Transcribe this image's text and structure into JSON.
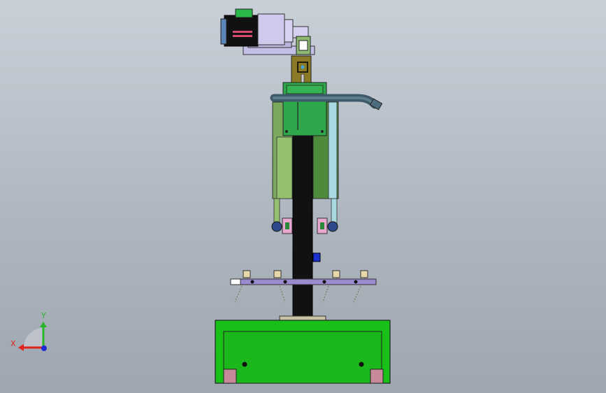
{
  "viewport": {
    "background_top": "#c9d0d8",
    "background_bottom": "#9ea6b0"
  },
  "triad": {
    "x_label": "X",
    "y_label": "Y",
    "x_color": "#e0241c",
    "y_color": "#2bb32b",
    "z_color": "#1e2bd6"
  },
  "model": {
    "motor_color": "#111111",
    "gearbox_color": "#c8c2e8",
    "mount_plate_color": "#b8b2dc",
    "bracket_color": "#8a7a28",
    "green_panel_color": "#2ea84a",
    "side_panel_color": "#6f9c52",
    "column_color": "#111111",
    "hose_color": "#3f5a6a",
    "rail_color": "#9a8ad0",
    "base_color": "#18c018",
    "blue_block_color": "#1a2fd0"
  }
}
